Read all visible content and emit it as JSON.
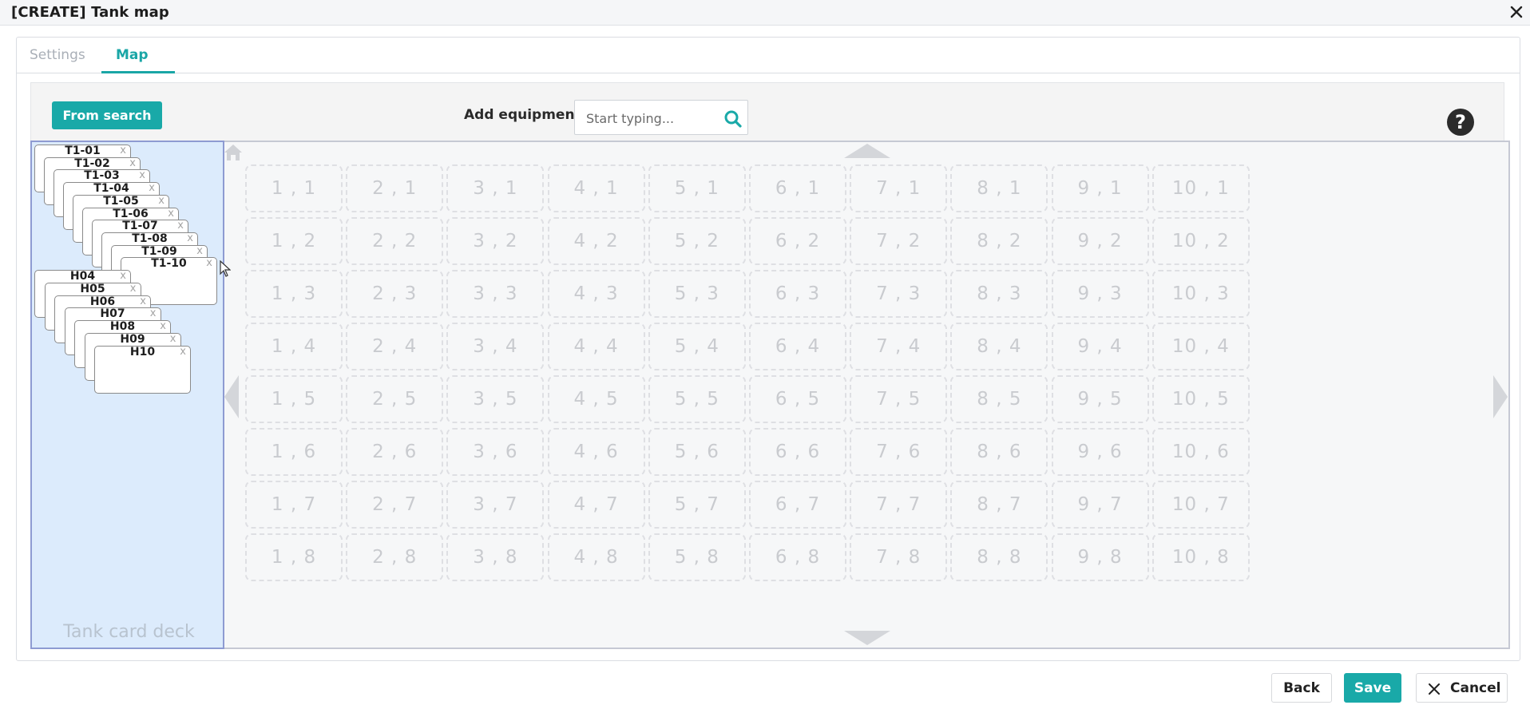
{
  "window": {
    "title": "[CREATE] Tank map",
    "close_icon": "close-icon"
  },
  "tabs": [
    {
      "label": "Settings",
      "active": false
    },
    {
      "label": "Map",
      "active": true
    }
  ],
  "toolbar": {
    "from_search_label": "From search",
    "add_equipment_label": "Add equipment",
    "search_placeholder": "Start typing...",
    "search_value": "",
    "help_icon": "?"
  },
  "deck": {
    "label": "Tank card deck",
    "close_glyph": "x",
    "cards": [
      {
        "name": "T1-01"
      },
      {
        "name": "T1-02"
      },
      {
        "name": "T1-03"
      },
      {
        "name": "T1-04"
      },
      {
        "name": "T1-05"
      },
      {
        "name": "T1-06"
      },
      {
        "name": "T1-07"
      },
      {
        "name": "T1-08"
      },
      {
        "name": "T1-09"
      },
      {
        "name": "T1-10"
      },
      {
        "name": "H04"
      },
      {
        "name": "H05"
      },
      {
        "name": "H06"
      },
      {
        "name": "H07"
      },
      {
        "name": "H08"
      },
      {
        "name": "H09"
      },
      {
        "name": "H10"
      }
    ]
  },
  "grid": {
    "rows": [
      [
        "1 , 1",
        "2 , 1",
        "3 , 1",
        "4 , 1",
        "5 , 1",
        "6 , 1",
        "7 , 1",
        "8 , 1",
        "9 , 1",
        "10 , 1"
      ],
      [
        "1 , 2",
        "2 , 2",
        "3 , 2",
        "4 , 2",
        "5 , 2",
        "6 , 2",
        "7 , 2",
        "8 , 2",
        "9 , 2",
        "10 , 2"
      ],
      [
        "1 , 3",
        "2 , 3",
        "3 , 3",
        "4 , 3",
        "5 , 3",
        "6 , 3",
        "7 , 3",
        "8 , 3",
        "9 , 3",
        "10 , 3"
      ],
      [
        "1 , 4",
        "2 , 4",
        "3 , 4",
        "4 , 4",
        "5 , 4",
        "6 , 4",
        "7 , 4",
        "8 , 4",
        "9 , 4",
        "10 , 4"
      ],
      [
        "1 , 5",
        "2 , 5",
        "3 , 5",
        "4 , 5",
        "5 , 5",
        "6 , 5",
        "7 , 5",
        "8 , 5",
        "9 , 5",
        "10 , 5"
      ],
      [
        "1 , 6",
        "2 , 6",
        "3 , 6",
        "4 , 6",
        "5 , 6",
        "6 , 6",
        "7 , 6",
        "8 , 6",
        "9 , 6",
        "10 , 6"
      ],
      [
        "1 , 7",
        "2 , 7",
        "3 , 7",
        "4 , 7",
        "5 , 7",
        "6 , 7",
        "7 , 7",
        "8 , 7",
        "9 , 7",
        "10 , 7"
      ],
      [
        "1 , 8",
        "2 , 8",
        "3 , 8",
        "4 , 8",
        "5 , 8",
        "6 , 8",
        "7 , 8",
        "8 , 8",
        "9 , 8",
        "10 , 8"
      ]
    ]
  },
  "footer": {
    "back_label": "Back",
    "save_label": "Save",
    "cancel_label": "Cancel"
  },
  "colors": {
    "accent": "#19a9a8",
    "deck_bg": "#dcebfc",
    "deck_border": "#8e9bd2"
  }
}
